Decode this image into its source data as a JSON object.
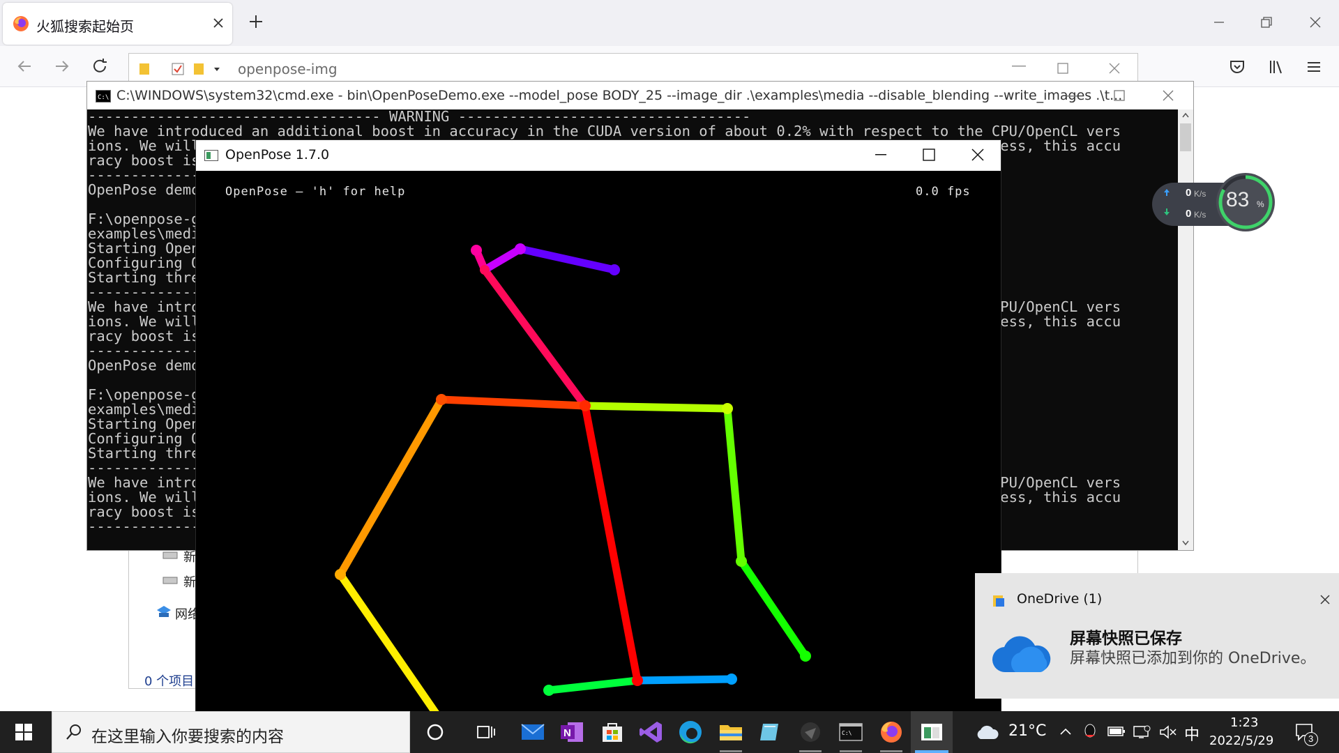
{
  "browser": {
    "tab_title": "火狐搜索起始页",
    "new_tab_symbol": "+"
  },
  "explorer": {
    "address": "openpose-img",
    "nav_items": [
      "新",
      "新",
      "网络"
    ],
    "status": "0 个项目"
  },
  "cmd": {
    "title": "C:\\WINDOWS\\system32\\cmd.exe - bin\\OpenPoseDemo.exe  --model_pose BODY_25 --image_dir .\\examples\\media --disable_blending --write_images .\\t...",
    "lines": [
      "---------------------------------- WARNING ----------------------------------",
      "We have introduced an additional boost in accuracy in the CUDA version of about 0.2% with respect to the CPU/OpenCL vers",
      "ions. We will not port this to CPU given the considerable slow down in speed it would add to it. Nevertheless, this accu",
      "racy boost is almost insignificant so the CPU/OpenCL versions can be safely used.",
      "-----------------------------------------------------------------------------",
      "OpenPose demo successfully finished. Total time: 1.234 seconds.",
      "",
      "F:\\openpose-gpu-1.7.0>bin\\OpenPoseDemo.exe --model_pose BODY_25 --image_dir .",
      "examples\\media --disable_blending --write_images .\\test",
      "Starting OpenPose demo...",
      "Configuring OpenPose...",
      "Starting thread(s)...",
      "---------------------------------- WARNING ----------------------------------",
      "We have introduced an additional boost in accuracy in the CUDA version of about 0.2% with respect to the CPU/OpenCL vers",
      "ions. We will not port this to CPU given the considerable slow down in speed it would add to it. Nevertheless, this accu",
      "racy boost is almost insignificant so the CPU/OpenCL versions can be safely used.",
      "-----------------------------------------------------------------------------",
      "OpenPose demo successfully finished. Total time: 1.234 seconds.",
      "",
      "F:\\openpose-gpu-1.7.0>bin\\OpenPoseDemo.exe --model_pose BODY_25 --image_dir .\\",
      "examples\\media --disable_blending --write_images .\\test",
      "Starting OpenPose demo...",
      "Configuring OpenPose...",
      "Starting thread(s)...",
      "---------------------------------- WARNING ----------------------------------",
      "We have introduced an additional boost in accuracy in the CUDA version of about 0.2% with respect to the CPU/OpenCL vers",
      "ions. We will not port this to CPU given the considerable slow down in speed it would add to it. Nevertheless, this accu",
      "racy boost is almost insignificant so the CPU/OpenCL versions can be safely used.",
      "-----------------------------------------------------------------------------"
    ]
  },
  "openpose": {
    "title": "OpenPose 1.7.0",
    "overlay_left": "OpenPose — 'h' for help",
    "overlay_right": "0.0 fps"
  },
  "netwidget": {
    "upload": "0",
    "download": "0",
    "unit": "K/s",
    "percent": "83",
    "percent_sign": "%"
  },
  "toast": {
    "app": "OneDrive (1)",
    "heading": "屏幕快照已保存",
    "body": "屏幕快照已添加到你的 OneDrive。"
  },
  "taskbar": {
    "search_placeholder": "在这里输入你要搜索的内容",
    "weather": "21°C",
    "ime": "中",
    "time": "1:23",
    "date": "2022/5/29",
    "notification_count": "3"
  },
  "colors": {
    "taskbar": "#202020",
    "console_bg": "#0c0c0c",
    "toast_bg": "#e6e6e6"
  }
}
